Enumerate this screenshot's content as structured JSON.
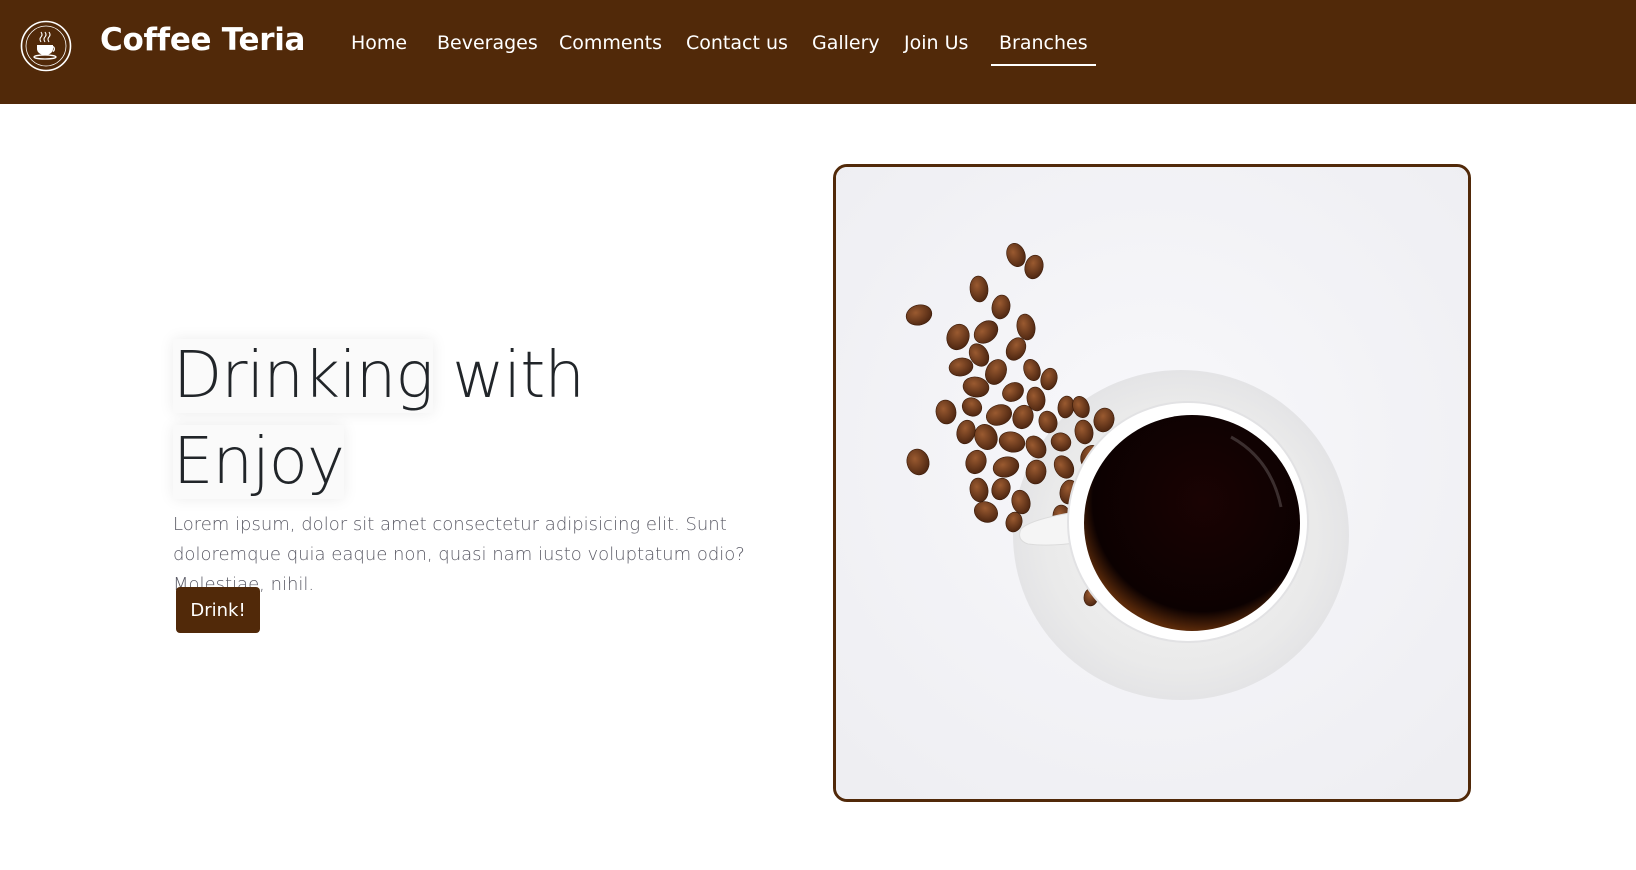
{
  "brand": {
    "name": "Coffee Teria",
    "logo_icon": "coffee-cup-logo-icon"
  },
  "nav": {
    "items": [
      {
        "label": "Home",
        "active": false
      },
      {
        "label": "Beverages",
        "active": false
      },
      {
        "label": "Comments",
        "active": false
      },
      {
        "label": "Contact us",
        "active": false
      },
      {
        "label": "Gallery",
        "active": false
      },
      {
        "label": "Join Us",
        "active": false
      },
      {
        "label": "Branches",
        "active": true
      }
    ]
  },
  "hero": {
    "title_word1": "Drinking",
    "title_word2": "with",
    "title_word3": "Enjoy",
    "description": "Lorem ipsum, dolor sit amet consectetur adipisicing elit. Sunt doloremque quia eaque non, quasi nam iusto voluptatum odio? Molestiae, nihil.",
    "button_label": "Drink!"
  },
  "colors": {
    "primary": "#512909",
    "text": "#212529",
    "muted": "#5b5b66"
  }
}
